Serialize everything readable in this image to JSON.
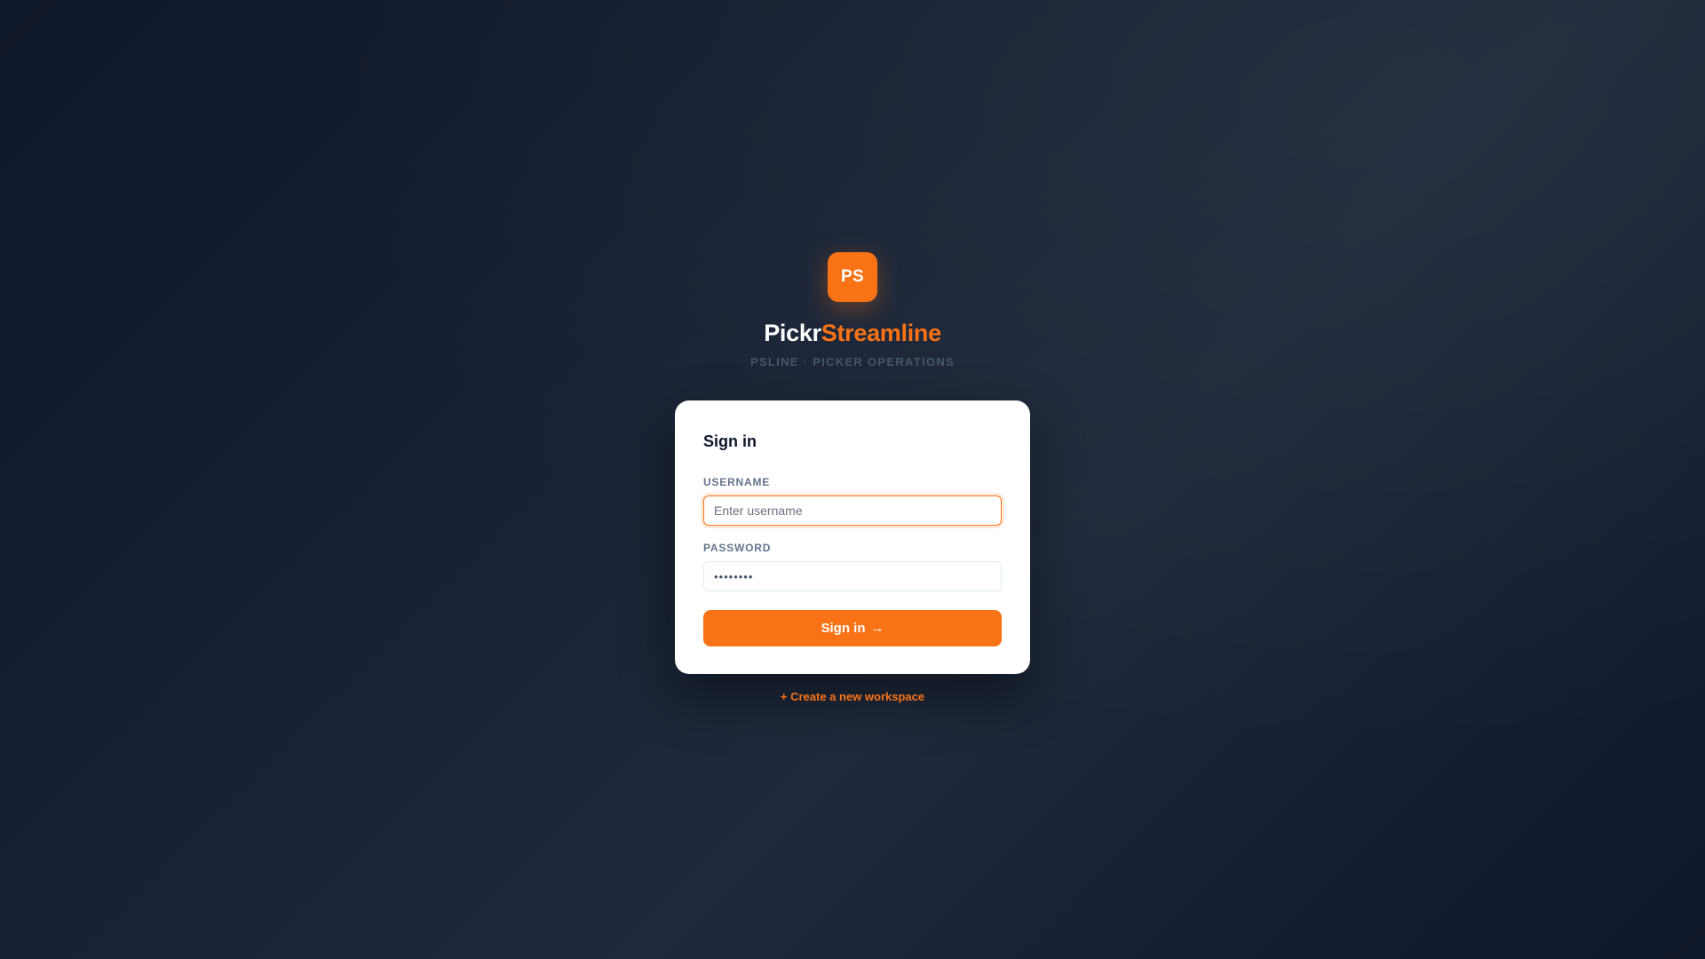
{
  "brand": {
    "logo_text": "PS",
    "name_part1": "Pickr",
    "name_part2": "Streamline",
    "tagline": "PSLINE · PICKER OPERATIONS",
    "accent_color": "#f97316"
  },
  "signin": {
    "title": "Sign in",
    "username_label": "USERNAME",
    "username_placeholder": "Enter username",
    "username_value": "",
    "password_label": "PASSWORD",
    "password_value": "••••••••",
    "submit_label": "Sign in",
    "submit_arrow": "→"
  },
  "footer": {
    "create_workspace_label": "+ Create a new workspace"
  }
}
